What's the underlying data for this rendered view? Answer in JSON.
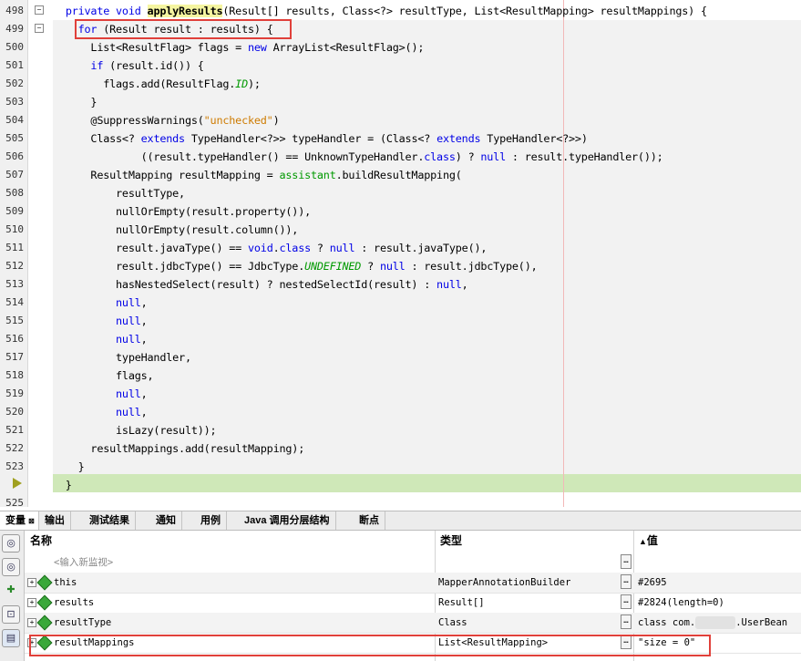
{
  "editor": {
    "lines": [
      {
        "n": "498",
        "tokens": [
          [
            "",
            "  "
          ],
          [
            "kw",
            "private void "
          ],
          [
            "hl",
            "applyResults"
          ],
          [
            "",
            "(Result[] results, Class<?> resultType, List<ResultMapping> resultMappings) {"
          ]
        ]
      },
      {
        "n": "499",
        "tokens": [
          [
            "",
            "    "
          ],
          [
            "kw",
            "for"
          ],
          [
            "",
            " (Result result : results) {"
          ]
        ]
      },
      {
        "n": "500",
        "tokens": [
          [
            "",
            "      List<ResultFlag> flags = "
          ],
          [
            "kw",
            "new"
          ],
          [
            "",
            " ArrayList<ResultFlag>();"
          ]
        ]
      },
      {
        "n": "501",
        "tokens": [
          [
            "",
            "      "
          ],
          [
            "kw",
            "if"
          ],
          [
            "",
            " (result.id()) {"
          ]
        ]
      },
      {
        "n": "502",
        "tokens": [
          [
            "",
            "        flags.add(ResultFlag."
          ],
          [
            "it",
            "ID"
          ],
          [
            "",
            ");"
          ]
        ]
      },
      {
        "n": "503",
        "tokens": [
          [
            "",
            "      }"
          ]
        ]
      },
      {
        "n": "504",
        "tokens": [
          [
            "",
            "      @SuppressWarnings("
          ],
          [
            "str",
            "\"unchecked\""
          ],
          [
            "",
            ")"
          ]
        ]
      },
      {
        "n": "505",
        "tokens": [
          [
            "",
            "      Class<? "
          ],
          [
            "kw",
            "extends"
          ],
          [
            "",
            " TypeHandler<?>> typeHandler = (Class<? "
          ],
          [
            "kw",
            "extends"
          ],
          [
            "",
            " TypeHandler<?>>)"
          ]
        ]
      },
      {
        "n": "506",
        "tokens": [
          [
            "",
            "              ((result.typeHandler() == UnknownTypeHandler."
          ],
          [
            "kw",
            "class"
          ],
          [
            "",
            ") ? "
          ],
          [
            "kw",
            "null"
          ],
          [
            "",
            " : result.typeHandler());"
          ]
        ]
      },
      {
        "n": "507",
        "tokens": [
          [
            "",
            "      ResultMapping resultMapping = "
          ],
          [
            "fn",
            "assistant"
          ],
          [
            "",
            ".buildResultMapping("
          ]
        ]
      },
      {
        "n": "508",
        "tokens": [
          [
            "",
            "          resultType,"
          ]
        ]
      },
      {
        "n": "509",
        "tokens": [
          [
            "",
            "          nullOrEmpty(result.property()),"
          ]
        ]
      },
      {
        "n": "510",
        "tokens": [
          [
            "",
            "          nullOrEmpty(result.column()),"
          ]
        ]
      },
      {
        "n": "511",
        "tokens": [
          [
            "",
            "          result.javaType() == "
          ],
          [
            "kw",
            "void"
          ],
          [
            "",
            "."
          ],
          [
            "kw",
            "class"
          ],
          [
            "",
            " ? "
          ],
          [
            "kw",
            "null"
          ],
          [
            "",
            " : result.javaType(),"
          ]
        ]
      },
      {
        "n": "512",
        "tokens": [
          [
            "",
            "          result.jdbcType() == JdbcType."
          ],
          [
            "it",
            "UNDEFINED"
          ],
          [
            "",
            " ? "
          ],
          [
            "kw",
            "null"
          ],
          [
            "",
            " : result.jdbcType(),"
          ]
        ]
      },
      {
        "n": "513",
        "tokens": [
          [
            "",
            "          hasNestedSelect(result) ? nestedSelectId(result) : "
          ],
          [
            "kw",
            "null"
          ],
          [
            "",
            ","
          ]
        ]
      },
      {
        "n": "514",
        "tokens": [
          [
            "",
            "          "
          ],
          [
            "kw",
            "null"
          ],
          [
            "",
            ","
          ]
        ]
      },
      {
        "n": "515",
        "tokens": [
          [
            "",
            "          "
          ],
          [
            "kw",
            "null"
          ],
          [
            "",
            ","
          ]
        ]
      },
      {
        "n": "516",
        "tokens": [
          [
            "",
            "          "
          ],
          [
            "kw",
            "null"
          ],
          [
            "",
            ","
          ]
        ]
      },
      {
        "n": "517",
        "tokens": [
          [
            "",
            "          typeHandler,"
          ]
        ]
      },
      {
        "n": "518",
        "tokens": [
          [
            "",
            "          flags,"
          ]
        ]
      },
      {
        "n": "519",
        "tokens": [
          [
            "",
            "          "
          ],
          [
            "kw",
            "null"
          ],
          [
            "",
            ","
          ]
        ]
      },
      {
        "n": "520",
        "tokens": [
          [
            "",
            "          "
          ],
          [
            "kw",
            "null"
          ],
          [
            "",
            ","
          ]
        ]
      },
      {
        "n": "521",
        "tokens": [
          [
            "",
            "          isLazy(result));"
          ]
        ]
      },
      {
        "n": "522",
        "tokens": [
          [
            "",
            "      resultMappings.add(resultMapping);"
          ]
        ]
      },
      {
        "n": "523",
        "tokens": [
          [
            "",
            "    }"
          ]
        ]
      },
      {
        "n": "",
        "tokens": [
          [
            "",
            "  }"
          ]
        ]
      },
      {
        "n": "525",
        "tokens": []
      }
    ]
  },
  "tabs": [
    "变量",
    "输出",
    "测试结果",
    "通知",
    "用例",
    "Java 调用分层结构",
    "断点"
  ],
  "table": {
    "headers": {
      "name": "名称",
      "type": "类型",
      "value": "值"
    },
    "new_watch": "<输入新监视>",
    "rows": [
      {
        "name": "this",
        "type": "MapperAnnotationBuilder",
        "value": "#2695"
      },
      {
        "name": "results",
        "type": "Result[]",
        "value": "#2824(length=0)"
      },
      {
        "name": "resultType",
        "type": "Class",
        "value_prefix": "class com.",
        "value_suffix": ".UserBean"
      },
      {
        "name": "resultMappings",
        "type": "List<ResultMapping>",
        "value": "\"size = 0\""
      }
    ]
  },
  "colors": {
    "keyword": "#0000e6",
    "string": "#ce7b00",
    "highlight_box": "#e0403a",
    "current_line": "#cfe8b8"
  }
}
